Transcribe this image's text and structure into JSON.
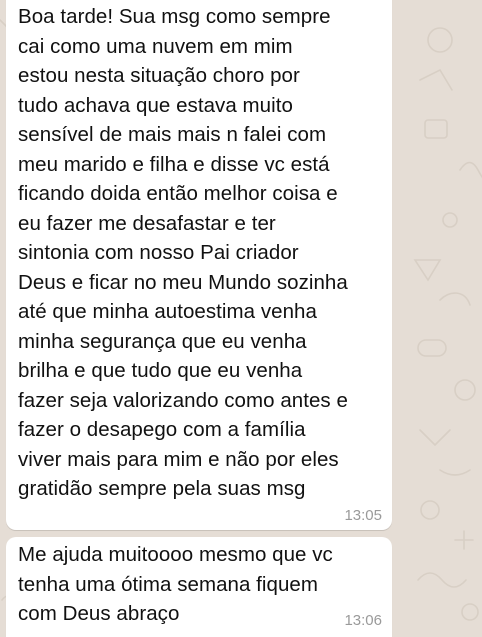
{
  "background_color": "#e5ddd5",
  "bubble_color": "#ffffff",
  "timestamp_color": "#9a9a9a",
  "messages": [
    {
      "lines": [
        "Boa tarde! Sua msg como sempre",
        "cai como uma nuvem em mim",
        "estou nesta situação choro por",
        "tudo achava que estava muito",
        "sensível de mais mais n falei com",
        "meu marido e filha e disse vc está",
        "ficando doida então melhor coisa e",
        "eu fazer me desafastar e ter",
        "sintonia com nosso Pai criador",
        "Deus e ficar no meu Mundo sozinha",
        "até que minha autoestima venha",
        "minha segurança que eu venha",
        "brilha e que tudo que eu venha",
        "fazer seja valorizando como antes e",
        "fazer o desapego com a família",
        "viver mais para mim e não por eles",
        "gratidão sempre pela suas msg"
      ],
      "time": "13:05"
    },
    {
      "lines": [
        "Me ajuda muitoooo mesmo que vc",
        "tenha uma ótima semana fiquem",
        "com Deus abraço"
      ],
      "time": "13:06"
    }
  ]
}
